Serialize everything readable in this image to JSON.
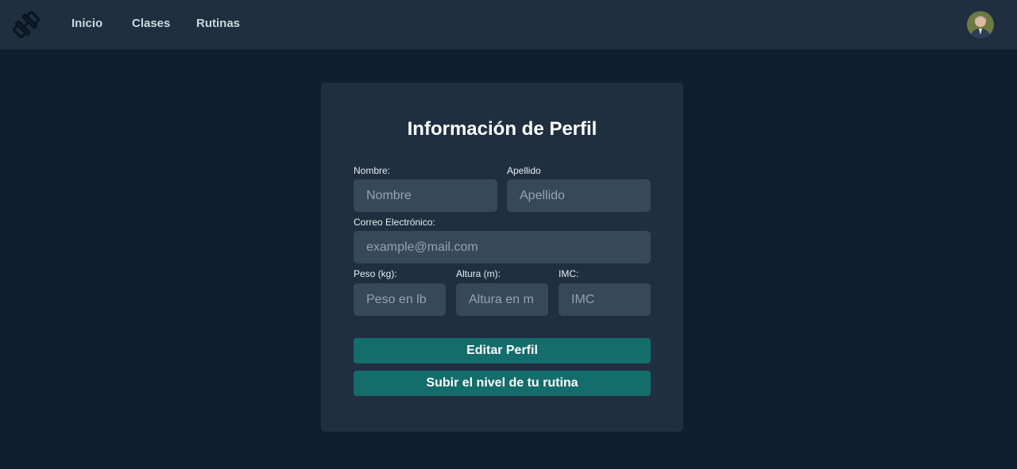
{
  "nav": {
    "links": [
      "Inicio",
      "Clases",
      "Rutinas"
    ]
  },
  "profile": {
    "title": "Información de Perfil",
    "fields": {
      "nombre": {
        "label": "Nombre:",
        "placeholder": "Nombre",
        "value": ""
      },
      "apellido": {
        "label": "Apellido",
        "placeholder": "Apellido",
        "value": ""
      },
      "correo": {
        "label": "Correo Electrónico:",
        "placeholder": "example@mail.com",
        "value": ""
      },
      "peso": {
        "label": "Peso (kg):",
        "placeholder": "Peso en lb",
        "value": ""
      },
      "altura": {
        "label": "Altura (m):",
        "placeholder": "Altura en m",
        "value": ""
      },
      "imc": {
        "label": "IMC:",
        "placeholder": "IMC",
        "value": ""
      }
    },
    "buttons": {
      "edit": "Editar Perfil",
      "level_up": "Subir el nivel de tu rutina"
    }
  },
  "colors": {
    "background": "#0f1f2e",
    "panel": "#1f2f3f",
    "input": "#374859",
    "accent": "#136d6b"
  },
  "icons": {
    "logo": "dumbbell-logo-icon",
    "avatar": "user-avatar"
  }
}
